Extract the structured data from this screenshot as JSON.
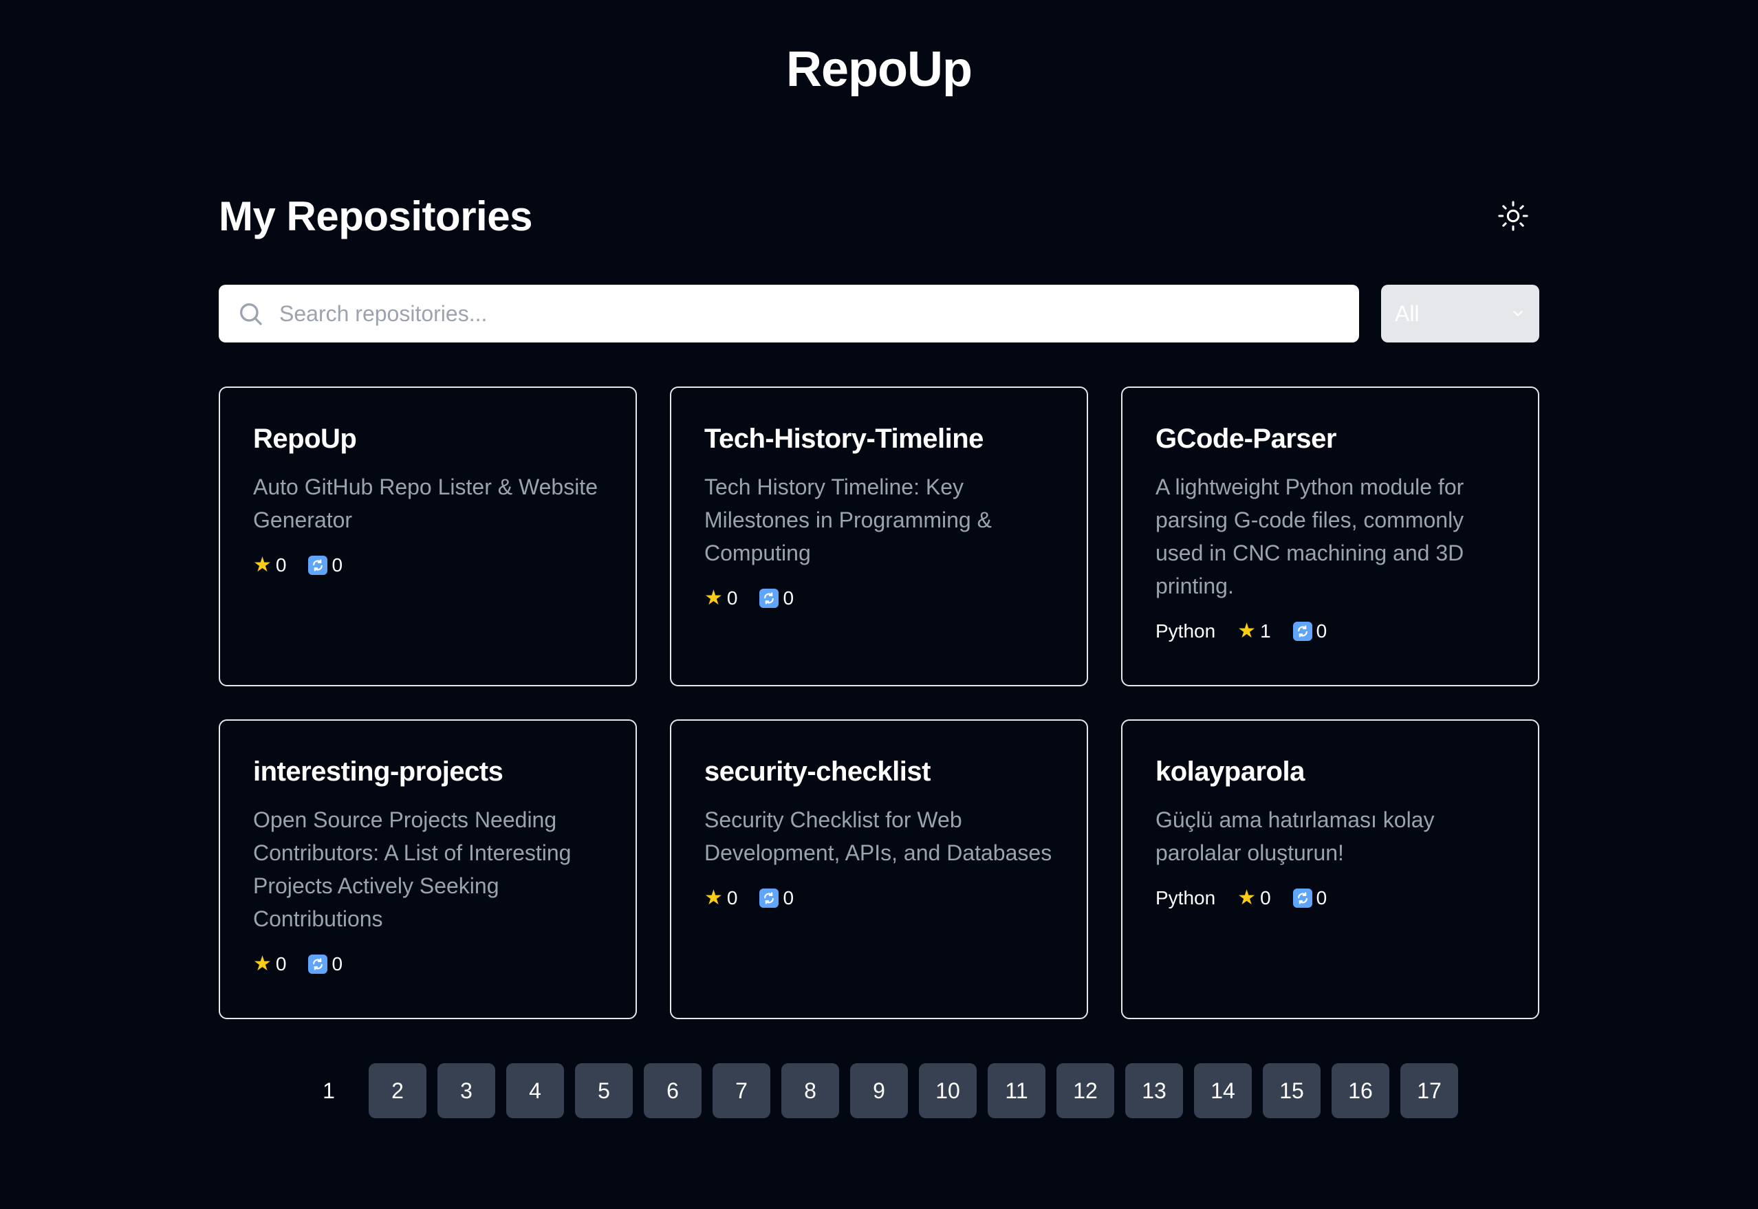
{
  "site_title": "RepoUp",
  "section_title": "My Repositories",
  "icons": {
    "theme_toggle": "sun-icon",
    "search": "search-icon",
    "dropdown": "chevron-down-icon",
    "star": "star-icon",
    "fork": "fork-icon"
  },
  "search": {
    "placeholder": "Search repositories...",
    "value": ""
  },
  "filter": {
    "selected": "All"
  },
  "repos": [
    {
      "name": "RepoUp",
      "description": "Auto GitHub Repo Lister & Website Generator",
      "language": "",
      "stars": "0",
      "forks": "0"
    },
    {
      "name": "Tech-History-Timeline",
      "description": "Tech History Timeline: Key Milestones in Programming & Computing",
      "language": "",
      "stars": "0",
      "forks": "0"
    },
    {
      "name": "GCode-Parser",
      "description": "A lightweight Python module for parsing G-code files, commonly used in CNC machining and 3D printing.",
      "language": "Python",
      "stars": "1",
      "forks": "0"
    },
    {
      "name": "interesting-projects",
      "description": "Open Source Projects Needing Contributors: A List of Interesting Projects Actively Seeking Contributions",
      "language": "",
      "stars": "0",
      "forks": "0"
    },
    {
      "name": "security-checklist",
      "description": "Security Checklist for Web Development, APIs, and Databases",
      "language": "",
      "stars": "0",
      "forks": "0"
    },
    {
      "name": "kolayparola",
      "description": "Güçlü ama hatırlaması kolay parolalar oluşturun!",
      "language": "Python",
      "stars": "0",
      "forks": "0"
    }
  ],
  "pagination": {
    "current": "1",
    "pages": [
      "1",
      "2",
      "3",
      "4",
      "5",
      "6",
      "7",
      "8",
      "9",
      "10",
      "11",
      "12",
      "13",
      "14",
      "15",
      "16",
      "17"
    ]
  },
  "colors": {
    "background": "#030712",
    "card_border": "#e5e7eb",
    "description": "#9ca3af",
    "page_button": "#374151",
    "star": "#facc15"
  }
}
